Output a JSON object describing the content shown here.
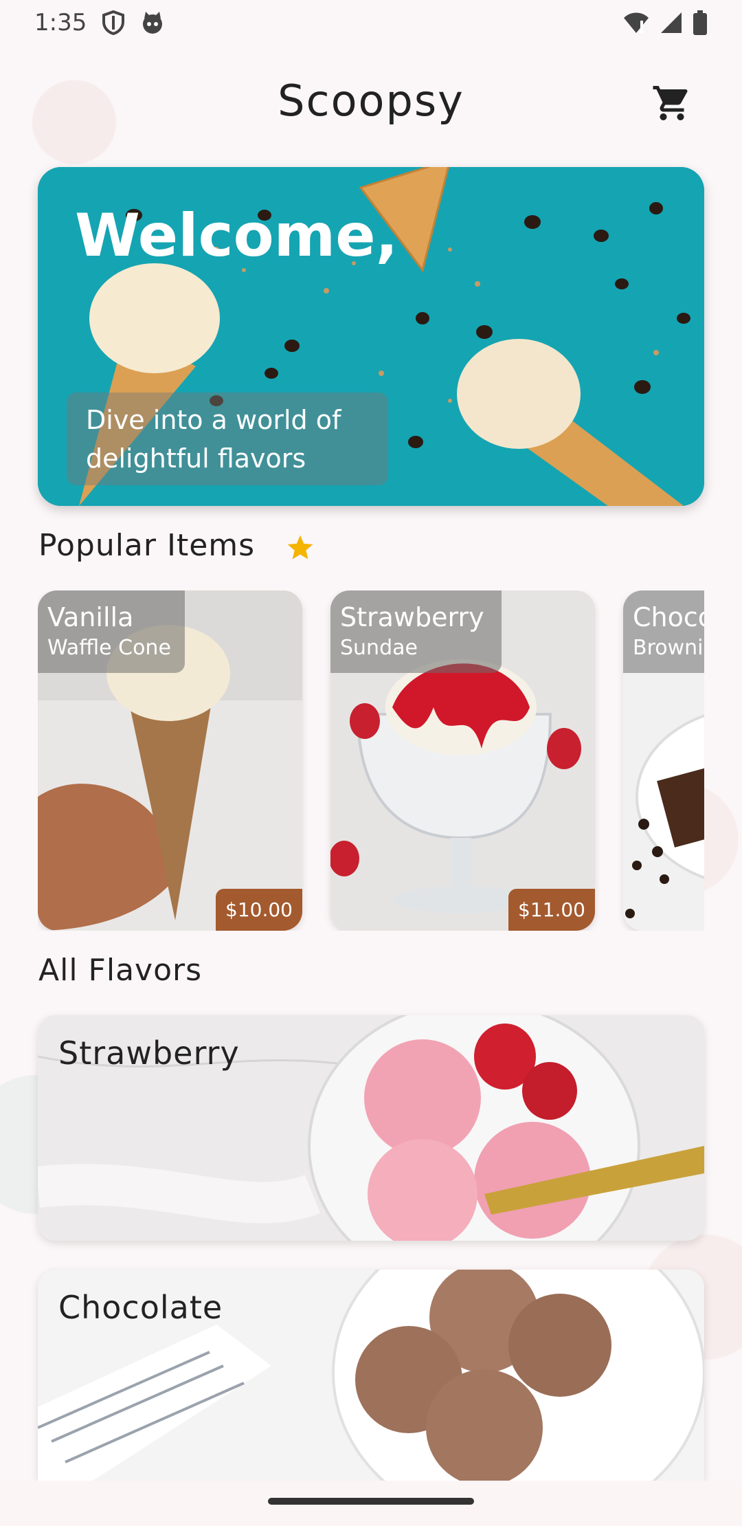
{
  "status_bar": {
    "time": "1:35"
  },
  "app_bar": {
    "title": "Scoopsy",
    "cart_icon": "cart-icon"
  },
  "hero": {
    "title": "Welcome,",
    "subtitle_line1": "Dive into a world of",
    "subtitle_line2": "delightful flavors"
  },
  "popular": {
    "title": "Popular Items",
    "items": [
      {
        "name": "Vanilla",
        "desc": "Waffle Cone",
        "price": "$10.00"
      },
      {
        "name": "Strawberry",
        "desc": "Sundae",
        "price": "$11.00"
      },
      {
        "name": "Chocolate",
        "desc": "Brownie"
      }
    ]
  },
  "all_flavors": {
    "title": "All Flavors",
    "items": [
      {
        "name": "Strawberry"
      },
      {
        "name": "Chocolate"
      }
    ]
  },
  "colors": {
    "accent_star": "#f4b400",
    "price_badge": "#a35a2e",
    "hero_bg": "#13a7b4"
  }
}
